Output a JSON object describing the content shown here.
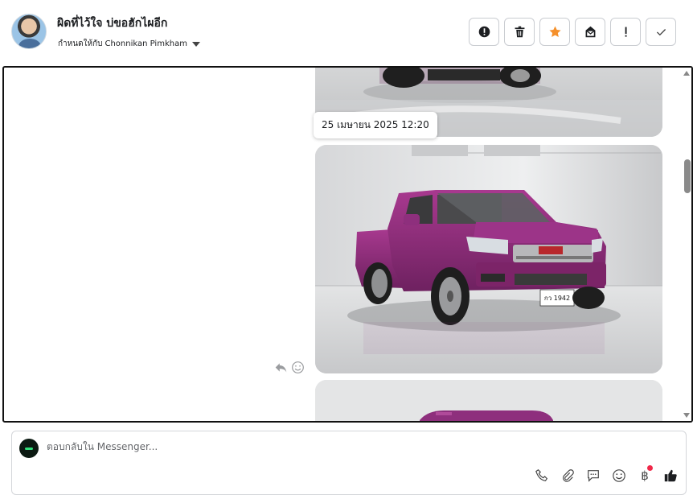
{
  "header": {
    "contact_name": "ผิดที่ไว้ใจ บ่ขอฮักไผอีก",
    "assign_prefix": "กำหนดให้กับ",
    "assignee": "Chonnikan Pimkham"
  },
  "actions": [
    {
      "icon": "alert-circle-icon"
    },
    {
      "icon": "trash-icon"
    },
    {
      "icon": "star-icon",
      "color": "#f5902b"
    },
    {
      "icon": "mark-unread-icon"
    },
    {
      "icon": "exclamation-icon"
    },
    {
      "icon": "check-icon"
    }
  ],
  "conversation": {
    "timestamp": "25 เมษายน 2025 12:20",
    "license_plate": "กว 1942",
    "car_color": "#8e2f7d"
  },
  "composer": {
    "placeholder": "ตอบกลับใน Messenger...",
    "currency_symbol": "฿"
  }
}
